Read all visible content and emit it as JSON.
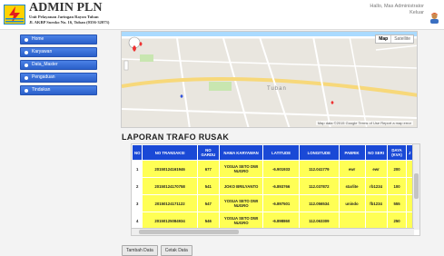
{
  "header": {
    "title": "ADMIN PLN",
    "subtitle_line1": "Unit Pelayanan Jaringan Rayon Tuban",
    "subtitle_line2": "Jl. AKBP Suroko No. 16, Tuban (0356-32073)",
    "greeting": "Hallo, Mas Administrator",
    "logout": "Keluar"
  },
  "sidebar": {
    "items": [
      {
        "label": "Home"
      },
      {
        "label": "Karyawan"
      },
      {
        "label": "Data_Master"
      },
      {
        "label": "Pengaduan"
      },
      {
        "label": "Tindakan"
      }
    ]
  },
  "map": {
    "map_label": "Map",
    "satellite_label": "Satellite",
    "footer": "Map data ©2015 Google  Terms of Use  Report a map error",
    "place_label": "Tuban"
  },
  "report": {
    "title": "LAPORAN TRAFO RUSAK",
    "columns": [
      "NO",
      "NO TRANSAKSI",
      "NO GARDU",
      "NAMA KARYAWAN",
      "LATITUDE",
      "LONGITUDE",
      "PABRIK",
      "NO SERI",
      "DAYA (KVA)",
      "J"
    ],
    "rows": [
      [
        "1",
        "20150124161946",
        "677",
        "YOSUA SETO DWI NUGRO",
        "-6.901933",
        "112.041779",
        "ewr",
        "ewr",
        "200",
        ""
      ],
      [
        "2",
        "20150124170758",
        "541",
        "JOKO BRILYANTO",
        "-6.893766",
        "112.037872",
        "starlite",
        "rb1234",
        "100",
        ""
      ],
      [
        "3",
        "20150124171122",
        "547",
        "YOSUA SETO DWI NUGRO",
        "-6.897501",
        "112.056534",
        "unindo",
        "fb1234",
        "555",
        ""
      ],
      [
        "4",
        "20150125084934",
        "546",
        "YOSUA SETO DWI NUGRO",
        "-6.898860",
        "112.063309",
        "",
        "",
        "250",
        ""
      ]
    ]
  },
  "buttons": {
    "add": "Tambah Data",
    "print": "Cetak Data"
  },
  "colors": {
    "header_row": "#1a49d6",
    "data_cell": "#ffff55",
    "menu": "#2a5fc9"
  }
}
